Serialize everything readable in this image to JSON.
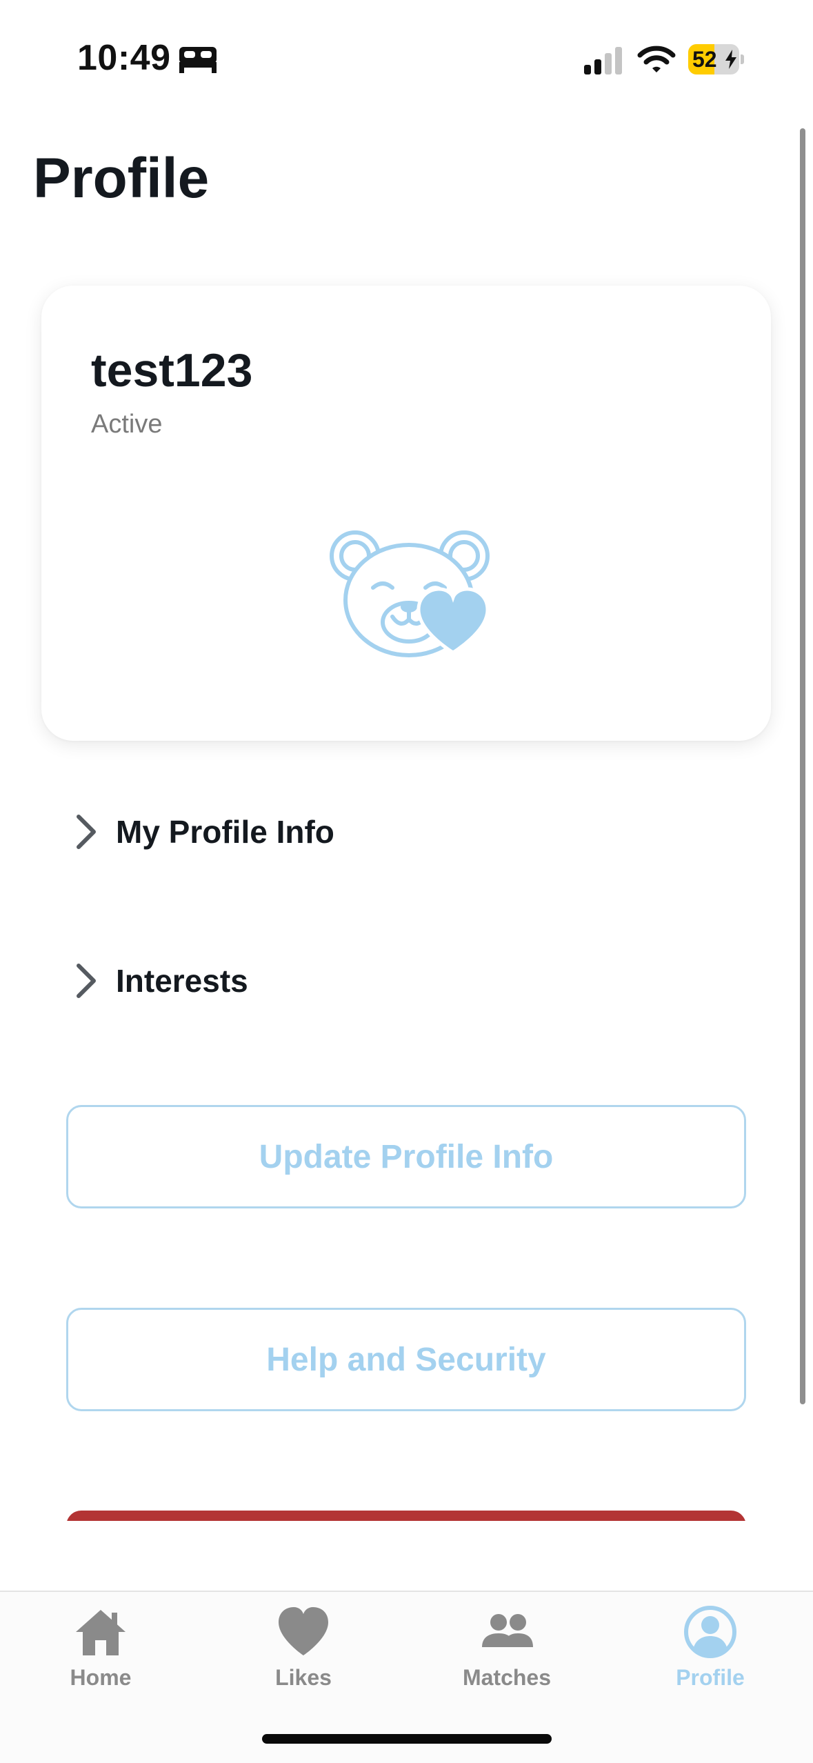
{
  "status_bar": {
    "time": "10:49",
    "battery_percent": "52",
    "battery_level": 0.52,
    "icons": [
      "bed-icon",
      "cellular-signal-icon",
      "wifi-icon",
      "battery-charging-icon"
    ]
  },
  "header": {
    "title": "Profile"
  },
  "profile_card": {
    "username": "test123",
    "status": "Active",
    "mascot_icon": "bear-with-heart-icon"
  },
  "sections": [
    {
      "label": "My Profile Info",
      "icon": "chevron-right-icon"
    },
    {
      "label": "Interests",
      "icon": "chevron-right-icon"
    }
  ],
  "buttons": {
    "update_profile": "Update Profile Info",
    "help_security": "Help and Security"
  },
  "tab_bar": {
    "items": [
      {
        "label": "Home",
        "icon": "home-icon",
        "active": false
      },
      {
        "label": "Likes",
        "icon": "heart-icon",
        "active": false
      },
      {
        "label": "Matches",
        "icon": "people-icon",
        "active": false
      },
      {
        "label": "Profile",
        "icon": "person-circle-icon",
        "active": true
      }
    ]
  },
  "colors": {
    "accent": "#a3d1ef",
    "accent_border": "#b0d6ee",
    "danger": "#b33434",
    "text_primary": "#14191f",
    "text_secondary": "#7a7a7a",
    "tab_inactive": "#8a8a8a",
    "battery_yellow": "#ffcc00"
  }
}
